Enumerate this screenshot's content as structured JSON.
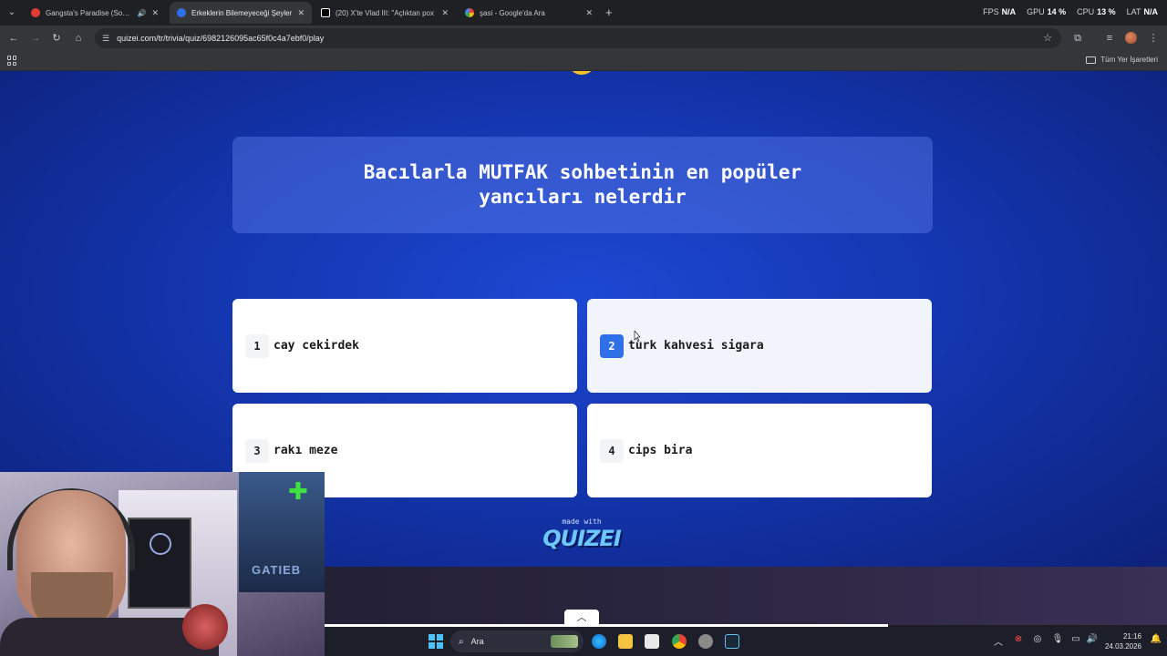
{
  "browser": {
    "tabs": [
      {
        "title": "Gangsta's Paradise (Soul/Bl",
        "favicon_color": "#e53935",
        "audio": true,
        "active": false
      },
      {
        "title": "Erkeklerin Bilemeyeceği Şeyler",
        "favicon_color": "#2f6fe8",
        "audio": false,
        "active": true
      },
      {
        "title": "(20) X'te Vlad III: \"Açlıktan pox",
        "favicon_color": "#ffffff",
        "audio": false,
        "active": false
      },
      {
        "title": "şasi - Google'da Ara",
        "favicon_color": "#4285f4",
        "audio": false,
        "active": false
      }
    ],
    "perf": [
      {
        "label": "FPS",
        "value": "N/A"
      },
      {
        "label": "GPU",
        "value": "14 %"
      },
      {
        "label": "CPU",
        "value": "13 %"
      },
      {
        "label": "LAT",
        "value": "N/A"
      }
    ],
    "url": "quizei.com/tr/trivia/quiz/6982126095ac65f0c4a7ebf0/play",
    "bookmarks_label": "Tüm Yer İşaretleri"
  },
  "quiz": {
    "question": "Bacılarla MUTFAK sohbetinin en popüler yancıları nelerdir",
    "answers": [
      {
        "num": "1",
        "text": "cay cekirdek"
      },
      {
        "num": "2",
        "text": "turk kahvesi sigara"
      },
      {
        "num": "3",
        "text": "rakı meze"
      },
      {
        "num": "4",
        "text": "cips bira"
      }
    ],
    "made_with": "made with",
    "brand": "QUIZEI"
  },
  "taskbar": {
    "search_placeholder": "Ara",
    "time": "21:16",
    "date": "24.03.2026"
  },
  "webcam": {
    "poster_text": "GATIEB"
  }
}
